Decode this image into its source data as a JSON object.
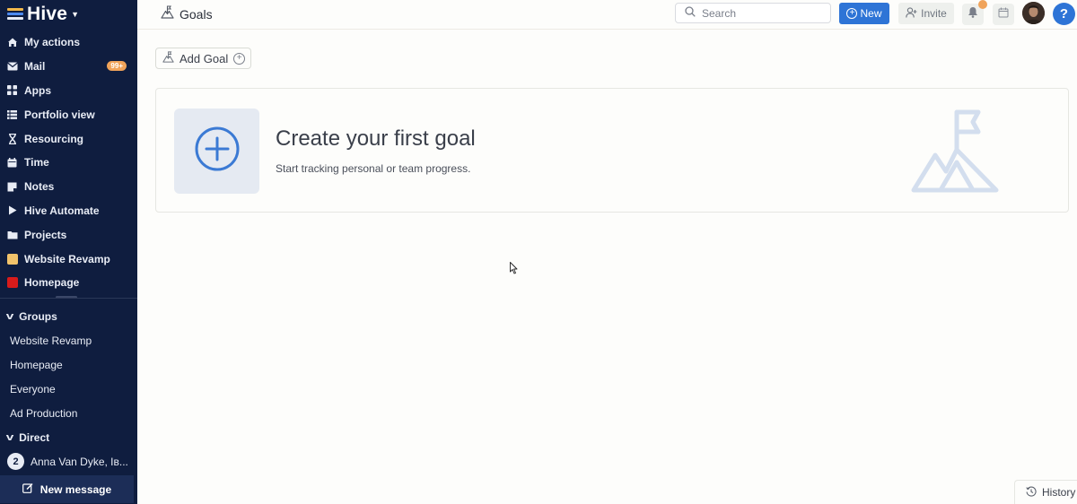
{
  "app": {
    "brand_name": "Hive",
    "brand_colors": [
      "#f2b84b",
      "#4d8af0",
      "#e8ecf5"
    ],
    "sidebar_bg": "#0f1d3f",
    "accent": "#2e74d6"
  },
  "sidebar": {
    "nav": [
      {
        "label": "My actions",
        "icon": "home-icon"
      },
      {
        "label": "Mail",
        "icon": "mail-icon",
        "badge": "99+"
      },
      {
        "label": "Apps",
        "icon": "apps-grid-icon"
      },
      {
        "label": "Portfolio view",
        "icon": "list-icon"
      },
      {
        "label": "Resourcing",
        "icon": "hourglass-icon"
      },
      {
        "label": "Time",
        "icon": "calendar-icon"
      },
      {
        "label": "Notes",
        "icon": "note-icon"
      },
      {
        "label": "Hive Automate",
        "icon": "play-icon"
      },
      {
        "label": "Projects",
        "icon": "folder-icon"
      },
      {
        "label": "Website Revamp",
        "icon": "project-color-square",
        "color": "#f2c36b"
      },
      {
        "label": "Homepage",
        "icon": "project-color-square",
        "color": "#d81b1b"
      }
    ],
    "groups_label": "Groups",
    "groups": [
      "Website Revamp",
      "Homepage",
      "Everyone",
      "Ad Production"
    ],
    "direct_label": "Direct",
    "direct": [
      {
        "count": "2",
        "label": "Anna Van Dyke, Iв..."
      }
    ],
    "new_message_label": "New message"
  },
  "topbar": {
    "page_title": "Goals",
    "search_placeholder": "Search",
    "new_label": "New",
    "invite_label": "Invite",
    "help_label": "?"
  },
  "main": {
    "add_goal_label": "Add Goal",
    "empty_state": {
      "title": "Create your first goal",
      "subtitle": "Start tracking personal or team progress."
    }
  },
  "footer": {
    "history_label": "History"
  }
}
